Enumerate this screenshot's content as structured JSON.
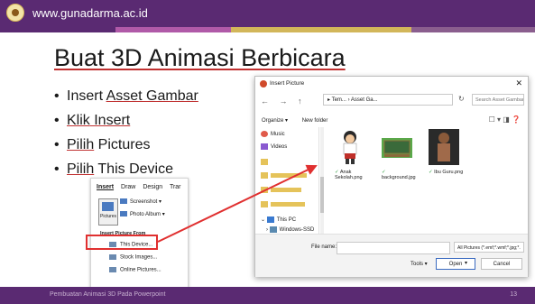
{
  "header": {
    "url": "www.gunadarma.ac.id"
  },
  "slide": {
    "title": "Buat 3D Animasi Berbicara",
    "bullets": [
      {
        "a": "Insert ",
        "b": "Asset Gambar"
      },
      {
        "a": "",
        "b": "Klik",
        "c": " Insert"
      },
      {
        "a": "",
        "b": "Pilih",
        "c": " Pictures"
      },
      {
        "a": "",
        "b": "Pilih",
        "c": " This Device"
      }
    ]
  },
  "ribbon": {
    "tabs": [
      "Insert",
      "Draw",
      "Design",
      "Trar"
    ],
    "pictures_label": "Pictures",
    "screenshot_label": "Screenshot ▾",
    "photo_album_label": "Photo Album ▾",
    "menu_header": "Insert Picture From",
    "menu_items": [
      "This Device...",
      "Stock Images...",
      "Online Pictures..."
    ]
  },
  "dialog": {
    "title": "Insert Picture",
    "close": "✕",
    "nav_glyphs": [
      "←",
      "→",
      "↑"
    ],
    "address": "▸ Tem... › Asset Ga...",
    "search_placeholder": "Search Asset Gambar 3D Suara",
    "toolbar": {
      "organize": "Organize ▾",
      "new_folder": "New folder"
    },
    "nav_items": [
      {
        "label": "Music",
        "icon": "music-icon"
      },
      {
        "label": "Videos",
        "icon": "videos-icon"
      },
      {
        "label": "This PC",
        "icon": "pc-icon"
      },
      {
        "label": "Windows-SSD",
        "icon": "drive-icon"
      }
    ],
    "files": [
      {
        "name": "Anak Sekolah.png"
      },
      {
        "name": "background.jpg"
      },
      {
        "name": "Ibu Guru.png"
      }
    ],
    "file_name_label": "File name:",
    "file_type": "All Pictures (*.emf;*.wmf;*.jpg;*.",
    "tools_label": "Tools ▾",
    "open_label": "Open",
    "cancel_label": "Cancel"
  },
  "footer": {
    "text": "Pembuatan Animasi 3D Pada Powerpoint",
    "page": "13"
  }
}
